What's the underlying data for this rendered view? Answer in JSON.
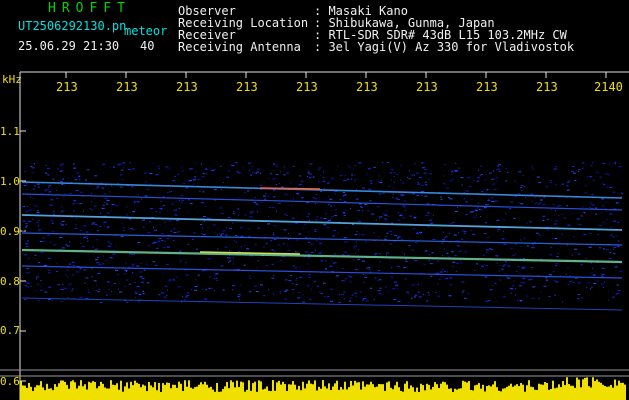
{
  "header": {
    "brand": "HROFFT",
    "filename": "UT2506292130.pn",
    "mode": "meteor",
    "datetime": "25.06.29 21:30",
    "count": "40",
    "info_labels": [
      "Observer",
      "Receiving Location",
      "Receiver",
      "Receiving Antenna"
    ],
    "info_values": [
      ": Masaki Kano",
      ": Shibukawa, Gunma, Japan",
      ": RTL-SDR SDR# 43dB L15 103.2MHz CW",
      ": 3el Yagi(V) Az 330 for Vladivostok"
    ]
  },
  "axis": {
    "unit": "kHz",
    "y_ticks": [
      "1.1",
      "1.0",
      "0.9",
      "0.8",
      "0.7",
      "0.6"
    ],
    "x_ticks": [
      "213",
      "213",
      "213",
      "213",
      "213",
      "213",
      "213",
      "213",
      "213",
      "2140"
    ]
  },
  "colors": {
    "background": "#000000",
    "label_yellow": "#f0e000",
    "brand_green": "#00d400",
    "text_cyan": "#00e0e0",
    "spectrum_blue": "#1030ff"
  }
}
